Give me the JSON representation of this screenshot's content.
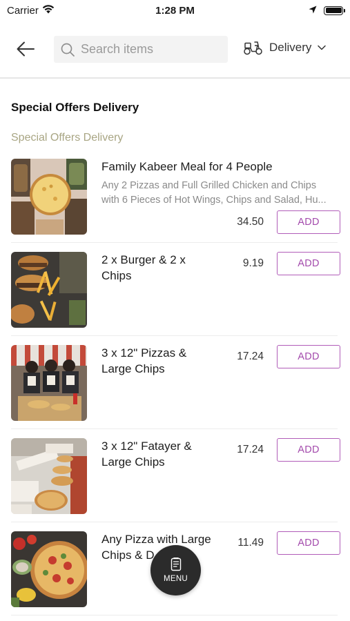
{
  "status_bar": {
    "carrier": "Carrier",
    "time": "1:28 PM"
  },
  "header": {
    "search_placeholder": "Search items",
    "delivery_mode": "Delivery"
  },
  "section_title": "Special Offers Delivery",
  "subsection_title": "Special Offers Delivery",
  "items": [
    {
      "name_lines": [
        "Family Kabeer Meal for 4 People"
      ],
      "description_lines": [
        "Any 2 Pizzas and Full Grilled Chicken and Chips",
        "with 6 Pieces of Hot Wings, Chips and Salad, Hu..."
      ],
      "price": "34.50",
      "add_label": "ADD"
    },
    {
      "name_lines": [
        "2 x Burger & 2 x",
        "Chips"
      ],
      "description_lines": [],
      "price": "9.19",
      "add_label": "ADD"
    },
    {
      "name_lines": [
        "3 x 12\" Pizzas &",
        "Large Chips"
      ],
      "description_lines": [],
      "price": "17.24",
      "add_label": "ADD"
    },
    {
      "name_lines": [
        "3 x 12\" Fatayer &",
        "Large Chips"
      ],
      "description_lines": [],
      "price": "17.24",
      "add_label": "ADD"
    },
    {
      "name_lines": [
        "Any Pizza with Large",
        "Chips & D"
      ],
      "description_lines": [],
      "price": "11.49",
      "add_label": "ADD"
    }
  ],
  "menu_button": {
    "label": "MENU"
  },
  "colors": {
    "accent": "#a34aac",
    "subsection": "#a8a583",
    "menu_fab": "#2b2b2b"
  },
  "icons": {
    "back": "back-arrow-icon",
    "search": "search-icon",
    "delivery": "scooter-icon",
    "menu": "menu-book-icon"
  }
}
